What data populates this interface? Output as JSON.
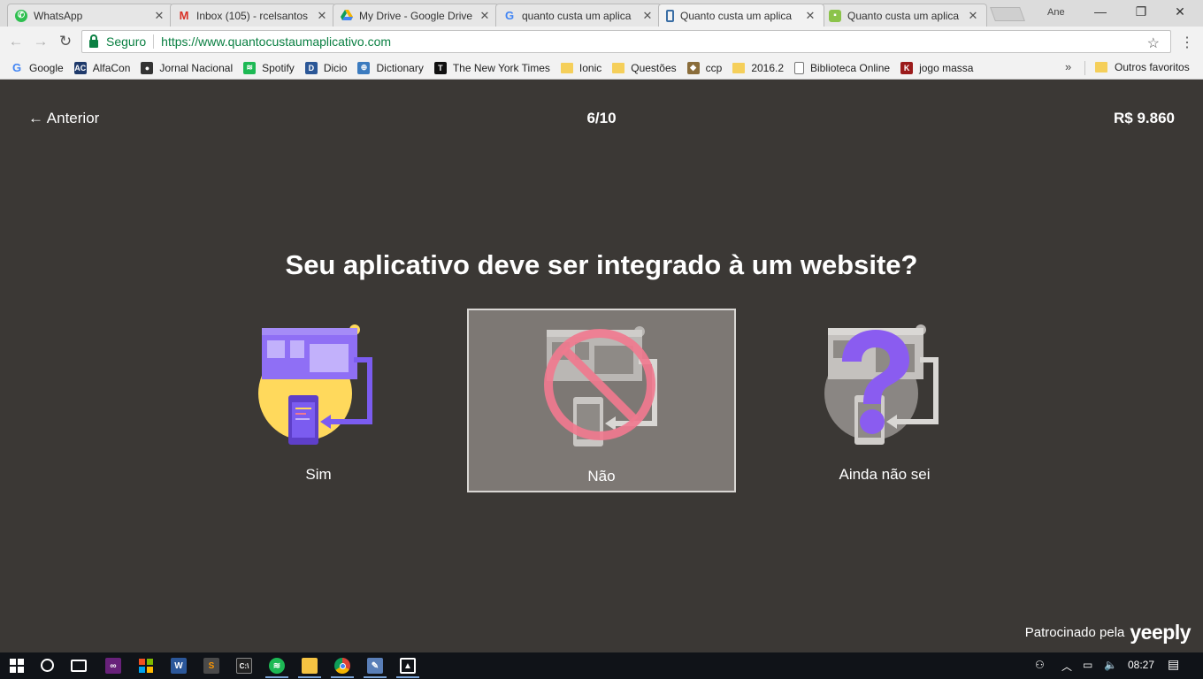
{
  "browser": {
    "tabs": [
      {
        "title": "WhatsApp",
        "icon": "whatsapp-icon",
        "color": "#2ebf4f"
      },
      {
        "title": "Inbox (105) - rcelsantos",
        "icon": "gmail-icon",
        "color": "#d93025"
      },
      {
        "title": "My Drive - Google Drive",
        "icon": "google-drive-icon",
        "color": "#f5b400"
      },
      {
        "title": "quanto custa um aplica",
        "icon": "google-icon",
        "color": "#4285f4"
      },
      {
        "title": "Quanto custa um aplica",
        "icon": "phone-icon",
        "color": "#3a6ea5"
      },
      {
        "title": "Quanto custa um aplica",
        "icon": "app-icon",
        "color": "#8bc34a"
      }
    ],
    "profile": "Ane",
    "security_label": "Seguro",
    "url": "https://www.quantocustaumaplicativo.com",
    "bookmarks": [
      {
        "label": "Google",
        "icon": "google-icon",
        "color": "#4285f4",
        "glyph": "G"
      },
      {
        "label": "AlfaCon",
        "icon": "alfacon-icon",
        "color": "#1f3a6b",
        "glyph": "AC"
      },
      {
        "label": "Jornal Nacional",
        "icon": "jornal-icon",
        "color": "#333333",
        "glyph": "●"
      },
      {
        "label": "Spotify",
        "icon": "spotify-icon",
        "color": "#1db954",
        "glyph": "≋"
      },
      {
        "label": "Dicio",
        "icon": "dicio-icon",
        "color": "#2b5797",
        "glyph": "D"
      },
      {
        "label": "Dictionary",
        "icon": "globe-icon",
        "color": "#3b7bbf",
        "glyph": "⊕"
      },
      {
        "label": "The New York Times",
        "icon": "nyt-icon",
        "color": "#111111",
        "glyph": "T"
      },
      {
        "label": "Ionic",
        "icon": "folder-icon",
        "color": "#f5cf5a",
        "glyph": ""
      },
      {
        "label": "Questões",
        "icon": "folder-icon",
        "color": "#f5cf5a",
        "glyph": ""
      },
      {
        "label": "ccp",
        "icon": "ccp-icon",
        "color": "#8a6d3b",
        "glyph": "◆"
      },
      {
        "label": "2016.2",
        "icon": "folder-icon",
        "color": "#f5cf5a",
        "glyph": ""
      },
      {
        "label": "Biblioteca Online",
        "icon": "page-icon",
        "color": "#ffffff",
        "glyph": ""
      },
      {
        "label": "jogo massa",
        "icon": "k-icon",
        "color": "#9b1b1b",
        "glyph": "K"
      }
    ],
    "more_bookmarks": "»",
    "other_bookmarks": "Outros favoritos"
  },
  "page": {
    "back_label": "← Anterior",
    "progress": "6/10",
    "price": "R$ 9.860",
    "question": "Seu aplicativo deve ser integrado à um website?",
    "options": [
      {
        "label": "Sim",
        "selected": false
      },
      {
        "label": "Não",
        "selected": true
      },
      {
        "label": "Ainda não sei",
        "selected": false
      }
    ],
    "sponsor_text": "Patrocinado pela",
    "sponsor_brand": "yeeply"
  },
  "colors": {
    "page_bg": "#3b3835",
    "selected_bg": "#7d7874",
    "purple": "#7b5cf0",
    "yellow": "#ffd95c",
    "no_sign": "#f07a8f"
  },
  "taskbar": {
    "apps": [
      "windows-start-icon",
      "cortana-icon",
      "task-view-icon",
      "visual-studio-icon",
      "office-icon",
      "word-icon",
      "sublime-icon",
      "cmd-icon",
      "spotify-icon",
      "file-explorer-icon",
      "chrome-icon",
      "paint-icon",
      "photos-icon"
    ],
    "time": "08:27"
  }
}
